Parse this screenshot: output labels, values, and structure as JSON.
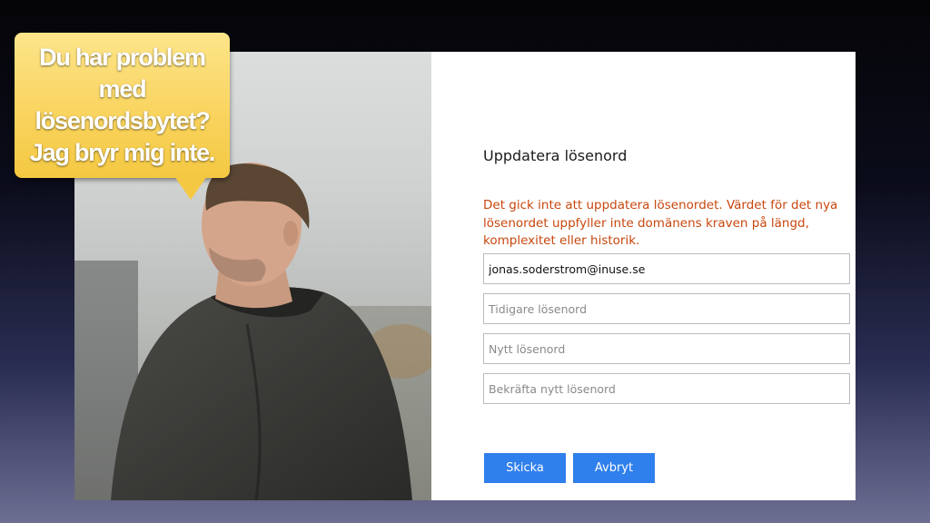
{
  "callout": {
    "lines": [
      "Du har problem med",
      "lösenordsbytet?",
      "Jag bryr mig inte."
    ]
  },
  "photo": {
    "subject": "man-in-rain-jacket"
  },
  "form": {
    "title": "Uppdatera lösenord",
    "error": "Det gick inte att uppdatera lösenordet. Värdet för det nya lösenordet uppfyller inte domänens kraven på längd, komplexitet eller historik.",
    "username_value": "jonas.soderstrom@inuse.se",
    "old_password_placeholder": "Tidigare lösenord",
    "new_password_placeholder": "Nytt lösenord",
    "confirm_password_placeholder": "Bekräfta nytt lösenord",
    "submit_label": "Skicka",
    "cancel_label": "Avbryt"
  },
  "colors": {
    "error": "#c8470e",
    "button": "#2f7fec",
    "callout": "#f9d45f"
  }
}
